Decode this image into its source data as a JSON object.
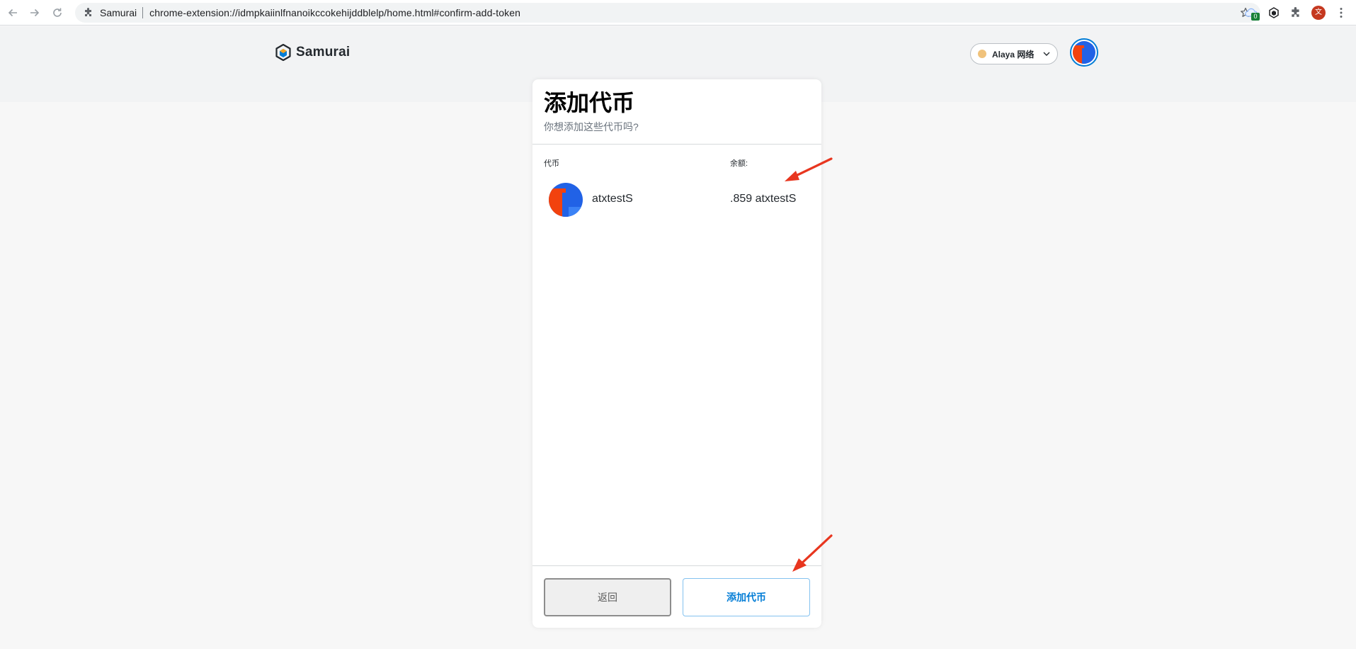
{
  "browser": {
    "site_name": "Samurai",
    "url": "chrome-extension://idmpkaiinlfnanoikccokehijddblelp/home.html#confirm-add-token",
    "extension_badge": "0",
    "profile_initial": "文"
  },
  "header": {
    "logo_text": "Samurai",
    "network_label": "Alaya 网络"
  },
  "confirm": {
    "title": "添加代币",
    "subtitle": "你想添加这些代币吗?",
    "col_token": "代币",
    "col_balance": "余额:",
    "token": {
      "symbol": "atxtestS",
      "balance": ".859 atxtestS"
    },
    "back_label": "返回",
    "add_label": "添加代币"
  },
  "colors": {
    "accent": "#037dd6",
    "annotation": "#e8361f",
    "identicon_orange": "#f2420e",
    "identicon_blue": "#2162e6"
  }
}
